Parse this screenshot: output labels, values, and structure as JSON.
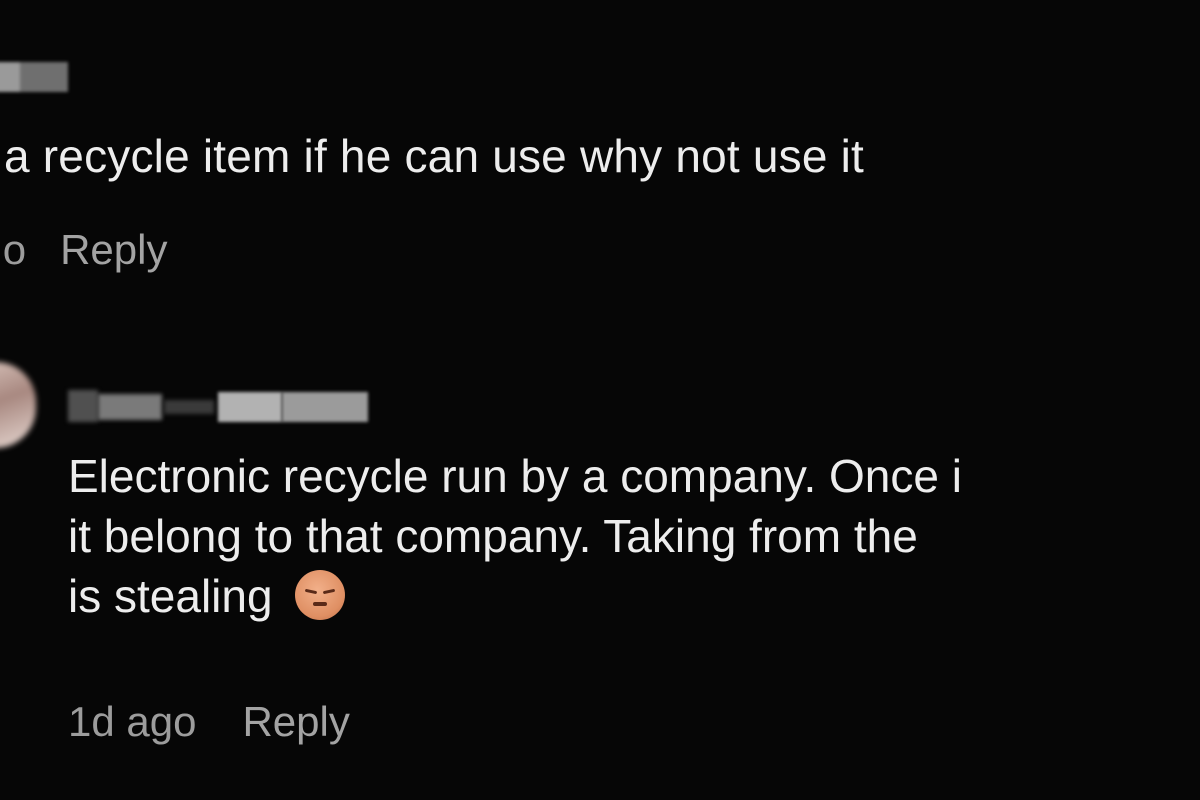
{
  "comments": [
    {
      "text": "a recycle item if he can use why not use it",
      "time": "ago",
      "reply_label": "Reply"
    },
    {
      "text_lines": [
        "Electronic recycle run by a company. Once i",
        "it belong to that company. Taking from the",
        "is stealing"
      ],
      "emoji": "relieved-face-icon",
      "time": "1d ago",
      "reply_label": "Reply"
    }
  ]
}
